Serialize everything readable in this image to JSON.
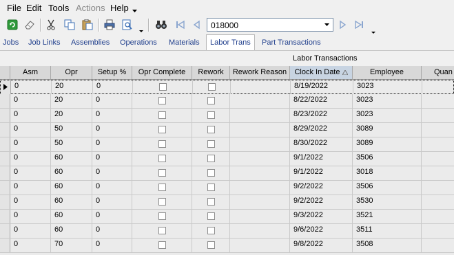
{
  "menu": {
    "file": "File",
    "edit": "Edit",
    "tools": "Tools",
    "actions": "Actions",
    "help": "Help"
  },
  "toolbar": {
    "job_combo_value": "018000"
  },
  "tabs": [
    "Jobs",
    "Job Links",
    "Assemblies",
    "Operations",
    "Materials",
    "Labor Trans",
    "Part Transactions"
  ],
  "active_tab": "Labor Trans",
  "grid": {
    "caption": "Labor Transactions",
    "columns": [
      "Asm",
      "Opr",
      "Setup %",
      "Opr Complete",
      "Rework",
      "Rework Reason",
      "Clock In Date",
      "Employee",
      "Quan"
    ],
    "sorted_column": "Clock In Date",
    "rows": [
      {
        "asm": "0",
        "opr": "20",
        "setup": "0",
        "opr_complete": false,
        "rework": false,
        "rework_reason": "",
        "clock_in": "8/19/2022",
        "employee": "3023"
      },
      {
        "asm": "0",
        "opr": "20",
        "setup": "0",
        "opr_complete": false,
        "rework": false,
        "rework_reason": "",
        "clock_in": "8/22/2022",
        "employee": "3023"
      },
      {
        "asm": "0",
        "opr": "20",
        "setup": "0",
        "opr_complete": false,
        "rework": false,
        "rework_reason": "",
        "clock_in": "8/23/2022",
        "employee": "3023"
      },
      {
        "asm": "0",
        "opr": "50",
        "setup": "0",
        "opr_complete": false,
        "rework": false,
        "rework_reason": "",
        "clock_in": "8/29/2022",
        "employee": "3089"
      },
      {
        "asm": "0",
        "opr": "50",
        "setup": "0",
        "opr_complete": false,
        "rework": false,
        "rework_reason": "",
        "clock_in": "8/30/2022",
        "employee": "3089"
      },
      {
        "asm": "0",
        "opr": "60",
        "setup": "0",
        "opr_complete": false,
        "rework": false,
        "rework_reason": "",
        "clock_in": "9/1/2022",
        "employee": "3506"
      },
      {
        "asm": "0",
        "opr": "60",
        "setup": "0",
        "opr_complete": false,
        "rework": false,
        "rework_reason": "",
        "clock_in": "9/1/2022",
        "employee": "3018"
      },
      {
        "asm": "0",
        "opr": "60",
        "setup": "0",
        "opr_complete": false,
        "rework": false,
        "rework_reason": "",
        "clock_in": "9/2/2022",
        "employee": "3506"
      },
      {
        "asm": "0",
        "opr": "60",
        "setup": "0",
        "opr_complete": false,
        "rework": false,
        "rework_reason": "",
        "clock_in": "9/2/2022",
        "employee": "3530"
      },
      {
        "asm": "0",
        "opr": "60",
        "setup": "0",
        "opr_complete": false,
        "rework": false,
        "rework_reason": "",
        "clock_in": "9/3/2022",
        "employee": "3521"
      },
      {
        "asm": "0",
        "opr": "60",
        "setup": "0",
        "opr_complete": false,
        "rework": false,
        "rework_reason": "",
        "clock_in": "9/6/2022",
        "employee": "3511"
      },
      {
        "asm": "0",
        "opr": "70",
        "setup": "0",
        "opr_complete": false,
        "rework": false,
        "rework_reason": "",
        "clock_in": "9/8/2022",
        "employee": "3508"
      }
    ]
  },
  "colors": {
    "accent": "#1f3e8c",
    "header_bg": "#d8d8d8",
    "grid_bg": "#ebebeb"
  }
}
